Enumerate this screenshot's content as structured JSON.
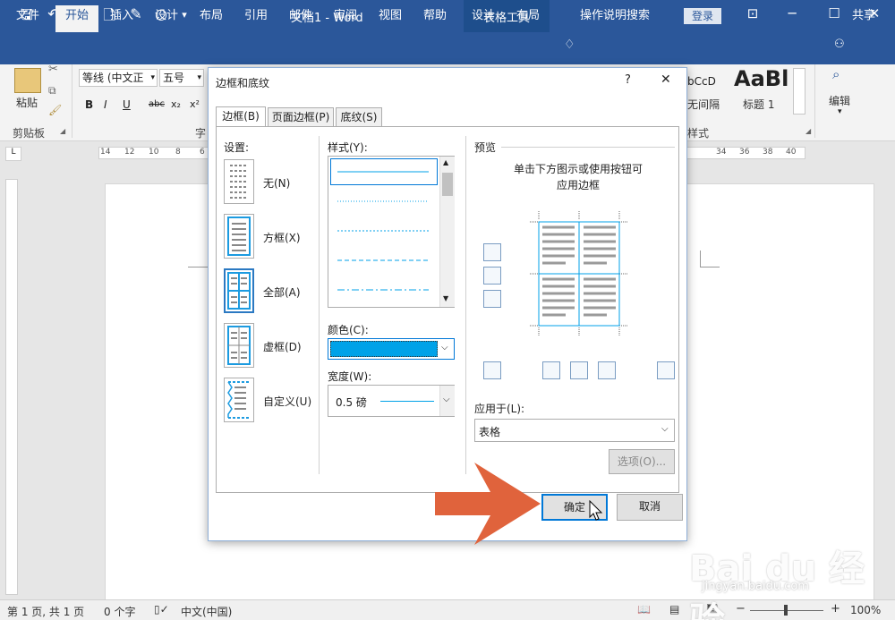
{
  "titlebar": {
    "doc_title": "文档1 - Word",
    "context_tools": "表格工具",
    "login": "登录"
  },
  "tabs": [
    "文件",
    "开始",
    "插入",
    "设计",
    "布局",
    "引用",
    "邮件",
    "审阅",
    "视图",
    "帮助",
    "设计",
    "布局"
  ],
  "tell_me": "操作说明搜索",
  "share": "共享",
  "ribbon": {
    "paste_label": "粘贴",
    "clipboard_group": "剪贴板",
    "font_name": "等线 (中文正",
    "font_size": "五号",
    "font_group_partial": "字",
    "style_preview_1": "bCcD",
    "style_preview_big": "AaBl",
    "style_name_1": "无间隔",
    "style_name_2": "标题 1",
    "styles_group_partial": "样式",
    "edit_label": "编辑"
  },
  "ruler_numbers": [
    "14",
    "12",
    "10",
    "8",
    "6",
    "34",
    "36",
    "38",
    "40",
    "42"
  ],
  "dialog": {
    "title": "边框和底纹",
    "help": "?",
    "close": "✕",
    "tabs": [
      "边框(B)",
      "页面边框(P)",
      "底纹(S)"
    ],
    "settings_label": "设置:",
    "settings": [
      "无(N)",
      "方框(X)",
      "全部(A)",
      "虚框(D)",
      "自定义(U)"
    ],
    "style_label": "样式(Y):",
    "color_label": "颜色(C):",
    "color_value": "#00a2e8",
    "width_label": "宽度(W):",
    "width_value": "0.5 磅",
    "preview_label": "预览",
    "preview_hint_1": "单击下方图示或使用按钮可",
    "preview_hint_2": "应用边框",
    "apply_label": "应用于(L):",
    "apply_value": "表格",
    "options_button": "选项(O)...",
    "ok_button": "确定",
    "cancel_button": "取消"
  },
  "status": {
    "page": "第 1 页, 共 1 页",
    "words": "0 个字",
    "lang": "中文(中国)",
    "zoom": "100%"
  },
  "watermark": {
    "brand": "Bai du 经验",
    "url": "jingyan.baidu.com"
  },
  "colors": {
    "word_blue": "#2b579a",
    "border_blue": "#00a2e8",
    "arrow": "#e0633c"
  }
}
